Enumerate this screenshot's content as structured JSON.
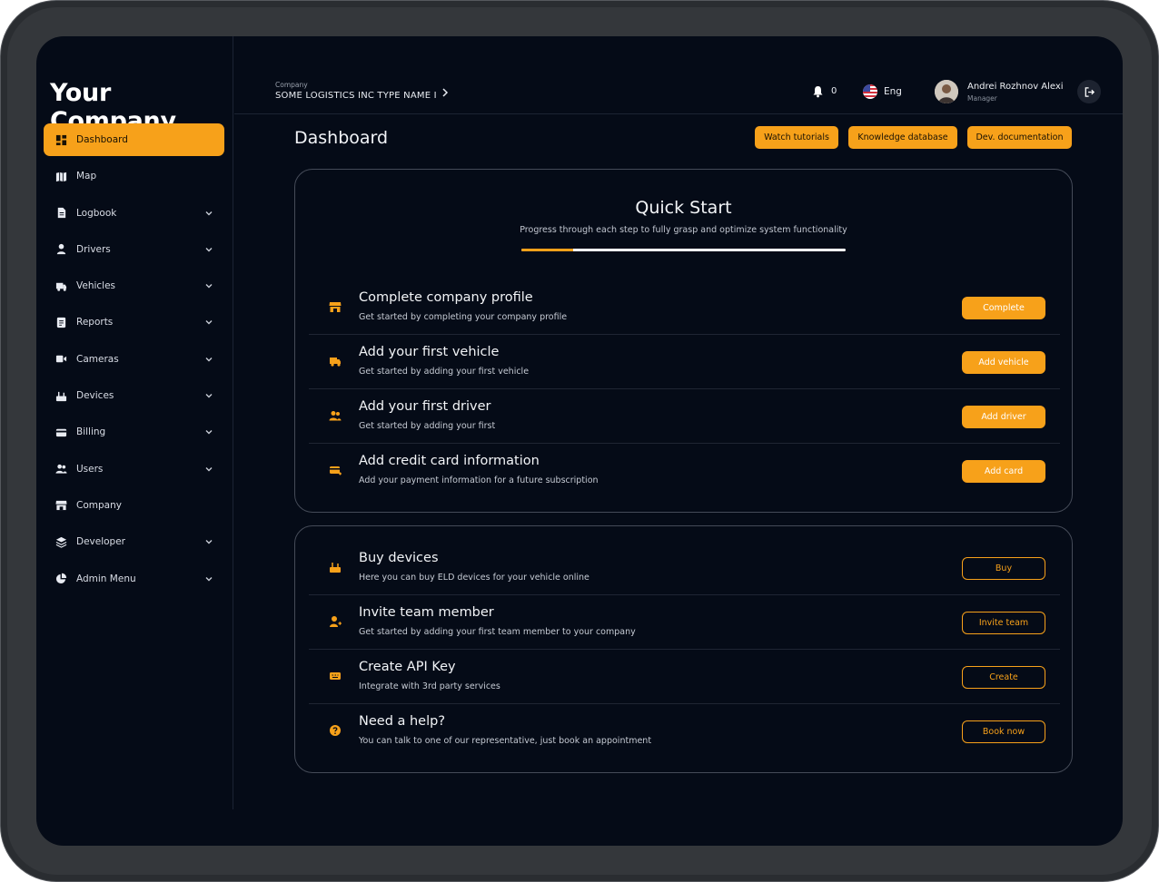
{
  "brand": "Your Company",
  "sidebar": {
    "items": [
      {
        "label": "Dashboard",
        "icon": "dashboard-icon",
        "active": true
      },
      {
        "label": "Map",
        "icon": "map-icon"
      },
      {
        "label": "Logbook",
        "icon": "logbook-icon"
      },
      {
        "label": "Drivers",
        "icon": "driver-icon"
      },
      {
        "label": "Vehicles",
        "icon": "truck-icon"
      },
      {
        "label": "Reports",
        "icon": "reports-icon"
      },
      {
        "label": "Cameras",
        "icon": "camera-icon"
      },
      {
        "label": "Devices",
        "icon": "device-icon"
      },
      {
        "label": "Billing",
        "icon": "billing-icon"
      },
      {
        "label": "Users",
        "icon": "users-icon"
      },
      {
        "label": "Company",
        "icon": "store-icon"
      },
      {
        "label": "Developer",
        "icon": "layers-icon"
      },
      {
        "label": "Admin Menu",
        "icon": "pie-icon"
      }
    ]
  },
  "header": {
    "company_caption": "Company",
    "company_name": "SOME LOGISTICS INC TYPE NAME I",
    "notifications": "0",
    "language": "Eng",
    "user_name": "Andrei Rozhnov Alexi",
    "user_role": "Manager"
  },
  "page": {
    "title": "Dashboard",
    "buttons": {
      "tutorials": "Watch tutorials",
      "knowledge": "Knowledge database",
      "docs": "Dev. documentation"
    }
  },
  "quick_start": {
    "title": "Quick Start",
    "subtitle": "Progress through each step to fully grasp and optimize system functionality",
    "progress": 0.16,
    "steps": [
      {
        "title": "Complete company profile",
        "desc": "Get started by completing your company profile",
        "button": "Complete",
        "icon": "store-icon"
      },
      {
        "title": "Add your first vehicle",
        "desc": "Get started by adding your first vehicle",
        "button": "Add vehicle",
        "icon": "truck-icon"
      },
      {
        "title": "Add your first driver",
        "desc": "Get started by adding your first",
        "button": "Add driver",
        "icon": "driver-icon"
      },
      {
        "title": "Add credit card information",
        "desc": "Add your payment information for a future subscription",
        "button": "Add card",
        "icon": "credit-card-icon"
      }
    ]
  },
  "extras": [
    {
      "title": "Buy devices",
      "desc": "Here you can buy ELD devices for your vehicle online",
      "button": "Buy",
      "icon": "device-icon"
    },
    {
      "title": "Invite team member",
      "desc": "Get started by adding your first team member to your company",
      "button": "Invite team",
      "icon": "add-user-icon"
    },
    {
      "title": "Create API Key",
      "desc": "Integrate with 3rd party services",
      "button": "Create",
      "icon": "api-key-icon"
    },
    {
      "title": "Need a help?",
      "desc": "You can talk to one of our representative, just book an appointment",
      "button": "Book now",
      "icon": "help-icon"
    }
  ],
  "colors": {
    "accent": "#f7a11a",
    "background": "#050b17",
    "border": "#454b58"
  }
}
